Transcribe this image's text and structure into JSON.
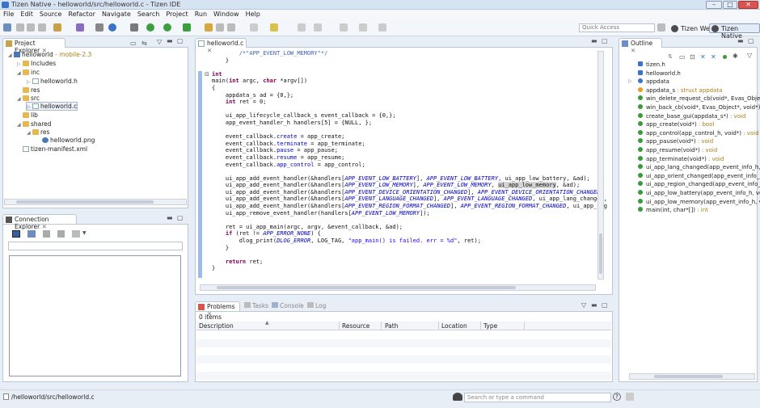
{
  "window": {
    "title": "Tizen Native - helloworld/src/helloworld.c - Tizen IDE",
    "minimize": "–",
    "maximize": "□",
    "close": "✕"
  },
  "menu": [
    "File",
    "Edit",
    "Source",
    "Refactor",
    "Navigate",
    "Search",
    "Project",
    "Run",
    "Window",
    "Help"
  ],
  "quick_access": {
    "placeholder": "Quick Access"
  },
  "perspectives": [
    {
      "label": "Tizen Web"
    },
    {
      "label": "Tizen Native"
    }
  ],
  "project_explorer": {
    "tab": "Project Explorer",
    "items": [
      {
        "label": "helloworld",
        "suffix": "- mobile-2.3"
      },
      {
        "label": "Includes"
      },
      {
        "label": "inc"
      },
      {
        "label": "helloworld.h"
      },
      {
        "label": "res"
      },
      {
        "label": "src"
      },
      {
        "label": "helloworld.c"
      },
      {
        "label": "lib"
      },
      {
        "label": "shared"
      },
      {
        "label": "res"
      },
      {
        "label": "helloworld.png"
      },
      {
        "label": "tizen-manifest.xml"
      }
    ]
  },
  "connection_explorer": {
    "tab": "Connection Explorer"
  },
  "editor": {
    "tab": "helloworld.c",
    "lines": [
      "        /*\"APP_EVENT_LOW_MEMORY\"*/",
      "    }",
      "",
      "int",
      "main(int argc, char *argv[])",
      "{",
      "    appdata_s ad = {0,};",
      "    int ret = 0;",
      "",
      "    ui_app_lifecycle_callback_s event_callback = {0,};",
      "    app_event_handler_h handlers[5] = {NULL, };",
      "",
      "    event_callback.create = app_create;",
      "    event_callback.terminate = app_terminate;",
      "    event_callback.pause = app_pause;",
      "    event_callback.resume = app_resume;",
      "    event_callback.app_control = app_control;",
      "",
      "    ui_app_add_event_handler(&handlers[APP_EVENT_LOW_BATTERY], APP_EVENT_LOW_BATTERY, ui_app_low_battery, &ad);",
      "    ui_app_add_event_handler(&handlers[APP_EVENT_LOW_MEMORY], APP_EVENT_LOW_MEMORY, ui_app_low_memory, &ad);",
      "    ui_app_add_event_handler(&handlers[APP_EVENT_DEVICE_ORIENTATION_CHANGED], APP_EVENT_DEVICE_ORIENTATION_CHANGED,",
      "    ui_app_add_event_handler(&handlers[APP_EVENT_LANGUAGE_CHANGED], APP_EVENT_LANGUAGE_CHANGED, ui_app_lang_changed,",
      "    ui_app_add_event_handler(&handlers[APP_EVENT_REGION_FORMAT_CHANGED], APP_EVENT_REGION_FORMAT_CHANGED, ui_app_reg",
      "    ui_app_remove_event_handler(handlers[APP_EVENT_LOW_MEMORY]);",
      "",
      "    ret = ui_app_main(argc, argv, &event_callback, &ad);",
      "    if (ret != APP_ERROR_NONE) {",
      "        dlog_print(DLOG_ERROR, LOG_TAG, \"app_main() is failed. err = %d\", ret);",
      "    }",
      "",
      "    return ret;",
      "}"
    ]
  },
  "outline": {
    "tab": "Outline",
    "items": [
      {
        "label": "tizen.h",
        "type": ""
      },
      {
        "label": "helloworld.h",
        "type": ""
      },
      {
        "label": "appdata",
        "type": ""
      },
      {
        "label": "appdata_s",
        "type": " : struct appdata"
      },
      {
        "label": "win_delete_request_cb(void*, Evas_Object*",
        "type": ""
      },
      {
        "label": "win_back_cb(void*, Evas_Object*, void*)",
        "type": " : void"
      },
      {
        "label": "create_base_gui(appdata_s*)",
        "type": " : void"
      },
      {
        "label": "app_create(void*)",
        "type": " : bool"
      },
      {
        "label": "app_control(app_control_h, void*)",
        "type": " : void"
      },
      {
        "label": "app_pause(void*)",
        "type": " : void"
      },
      {
        "label": "app_resume(void*)",
        "type": " : void"
      },
      {
        "label": "app_terminate(void*)",
        "type": " : void"
      },
      {
        "label": "ui_app_lang_changed(app_event_info_h, v",
        "type": ""
      },
      {
        "label": "ui_app_orient_changed(app_event_info_h, v",
        "type": ""
      },
      {
        "label": "ui_app_region_changed(app_event_info_h, v",
        "type": ""
      },
      {
        "label": "ui_app_low_battery(app_event_info_h, voi",
        "type": ""
      },
      {
        "label": "ui_app_low_memory(app_event_info_h, voi",
        "type": ""
      },
      {
        "label": "main(int, char*[])",
        "type": " : int"
      }
    ]
  },
  "bottom": {
    "tabs": [
      "Problems",
      "Tasks",
      "Console",
      "Log"
    ],
    "count": "0 items",
    "columns": [
      "Description",
      "Resource",
      "Path",
      "Location",
      "Type"
    ]
  },
  "status": {
    "path": "/helloworld/src/helloworld.c",
    "command_placeholder": "Search or type a command"
  },
  "colors": {
    "accent": "#3a73c8",
    "folder": "#e6b94e",
    "keyword": "#7f0055",
    "comment": "#3f5fbf",
    "constant": "#0000c0"
  }
}
